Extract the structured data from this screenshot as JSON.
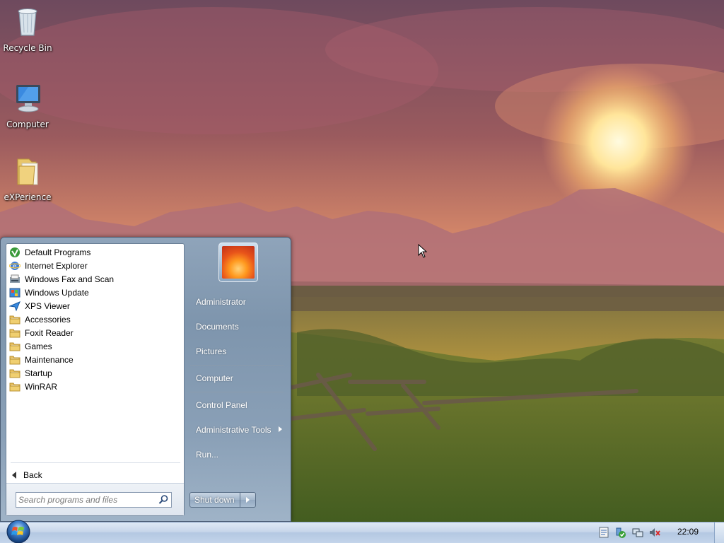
{
  "desktop": {
    "icons": [
      {
        "label": "Recycle Bin",
        "icon": "recycle-bin-icon"
      },
      {
        "label": "Computer",
        "icon": "computer-icon"
      },
      {
        "label": "eXPerience",
        "icon": "folder-icon"
      }
    ]
  },
  "start_menu": {
    "programs": [
      {
        "label": "Default Programs",
        "icon": "default-programs-icon"
      },
      {
        "label": "Internet Explorer",
        "icon": "internet-explorer-icon"
      },
      {
        "label": "Windows Fax and Scan",
        "icon": "fax-scan-icon"
      },
      {
        "label": "Windows Update",
        "icon": "windows-update-icon"
      },
      {
        "label": "XPS Viewer",
        "icon": "xps-viewer-icon"
      },
      {
        "label": "Accessories",
        "icon": "folder-icon"
      },
      {
        "label": "Foxit Reader",
        "icon": "folder-icon"
      },
      {
        "label": "Games",
        "icon": "folder-icon"
      },
      {
        "label": "Maintenance",
        "icon": "folder-icon"
      },
      {
        "label": "Startup",
        "icon": "folder-icon"
      },
      {
        "label": "WinRAR",
        "icon": "folder-icon"
      }
    ],
    "back_label": "Back",
    "search_placeholder": "Search programs and files",
    "right_items": {
      "administrator": "Administrator",
      "documents": "Documents",
      "pictures": "Pictures",
      "computer": "Computer",
      "control_panel": "Control Panel",
      "administrative_tools": "Administrative Tools",
      "run": "Run..."
    },
    "shutdown_label": "Shut down"
  },
  "taskbar": {
    "clock": "22:09",
    "tray_icons": [
      "action-center-icon",
      "security-check-icon",
      "network-icon",
      "volume-muted-icon"
    ]
  },
  "colors": {
    "taskbar": "#c7d6ea",
    "start_menu_frame": "#8aa0b7",
    "accent": "#1d5fb8"
  }
}
